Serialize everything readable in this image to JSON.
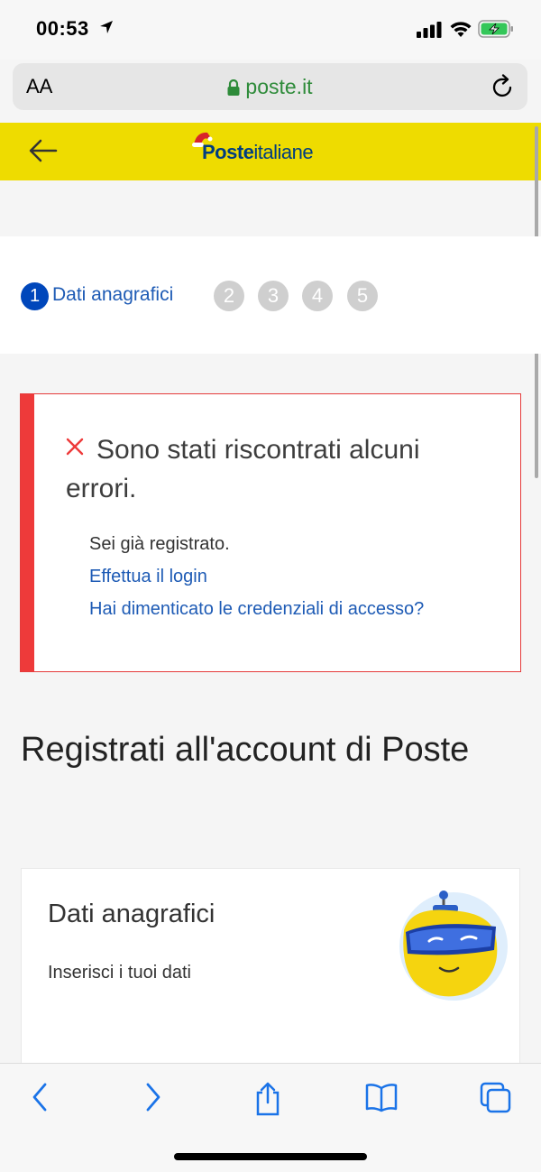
{
  "status_bar": {
    "time": "00:53"
  },
  "address_bar": {
    "text_size_label": "AA",
    "url": "poste.it"
  },
  "header": {
    "logo_bold": "Poste",
    "logo_light": "italiane"
  },
  "stepper": {
    "active_step": "1",
    "active_label": "Dati anagrafici",
    "steps": [
      "2",
      "3",
      "4",
      "5"
    ]
  },
  "error": {
    "title": "Sono stati riscontrati alcuni errori.",
    "message": "Sei già registrato.",
    "login_link": "Effettua il login",
    "forgot_link": "Hai dimenticato le credenziali di accesso?"
  },
  "page": {
    "heading": "Registrati all'account di Poste"
  },
  "card": {
    "title": "Dati anagrafici",
    "subtitle": "Inserisci i tuoi dati"
  },
  "colors": {
    "accent": "#0047bb",
    "brand_yellow": "#eedc00",
    "error": "#ee3a3a",
    "link": "#1e5bb5"
  }
}
